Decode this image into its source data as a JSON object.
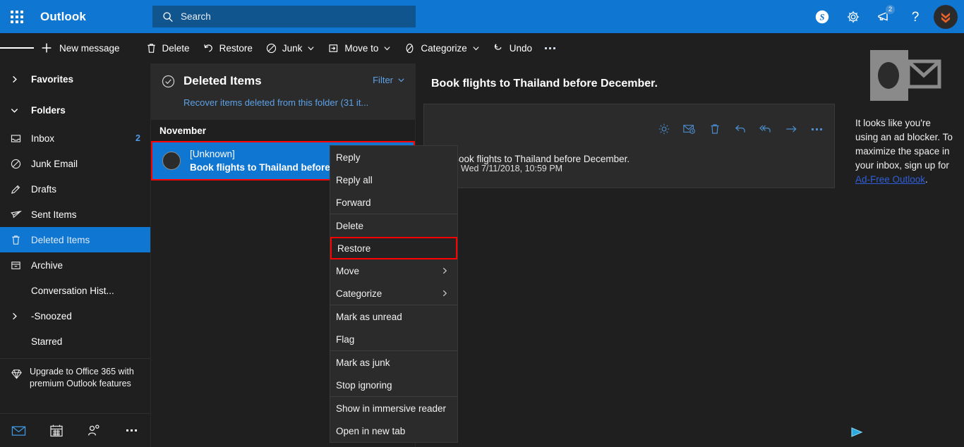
{
  "topbar": {
    "waffle_label": "app-launcher",
    "brand": "Outlook",
    "search_placeholder": "Search",
    "icons": {
      "skype": "skype-icon",
      "settings": "gear-icon",
      "announcements": "megaphone-icon",
      "help": "help-icon",
      "avatar": "user-avatar"
    },
    "notification_count": "2"
  },
  "commandbar": {
    "menu": "hamburger-menu",
    "new_message": "New message",
    "delete": "Delete",
    "restore": "Restore",
    "junk": "Junk",
    "move_to": "Move to",
    "categorize": "Categorize",
    "undo": "Undo",
    "more": "..."
  },
  "sidebar": {
    "favorites": "Favorites",
    "folders": "Folders",
    "items": [
      {
        "label": "Inbox",
        "icon": "inbox-icon",
        "count": "2"
      },
      {
        "label": "Junk Email",
        "icon": "junk-icon",
        "count": ""
      },
      {
        "label": "Drafts",
        "icon": "drafts-icon",
        "count": ""
      },
      {
        "label": "Sent Items",
        "icon": "sent-icon",
        "count": ""
      },
      {
        "label": "Deleted Items",
        "icon": "trash-icon",
        "count": ""
      },
      {
        "label": "Archive",
        "icon": "archive-icon",
        "count": ""
      },
      {
        "label": "Conversation Hist...",
        "icon": "",
        "count": ""
      },
      {
        "label": "-Snoozed",
        "icon": "",
        "count": ""
      },
      {
        "label": "Starred",
        "icon": "",
        "count": ""
      }
    ],
    "upgrade_text": "Upgrade to Office 365 with premium Outlook features",
    "bottom_nav": [
      "mail-icon",
      "calendar-icon",
      "people-icon",
      "more-icon"
    ]
  },
  "messagelist": {
    "title": "Deleted Items",
    "filter": "Filter",
    "recover_link": "Recover items deleted from this folder (31 it...",
    "group_header": "November",
    "items": [
      {
        "sender": "[Unknown]",
        "subject": "Book flights to Thailand before..",
        "selected": true
      }
    ]
  },
  "reading": {
    "subject": "Book flights to Thailand before December.",
    "date": "Wed 7/11/2018, 10:59 PM",
    "body": "Book flights to Thailand before December.",
    "actions": [
      "brightness-icon",
      "mail-snooze-icon",
      "trash-icon",
      "reply-icon",
      "reply-all-icon",
      "forward-icon",
      "more-icon"
    ]
  },
  "rail": {
    "logo": "outlook-logo",
    "text_before": "It looks like you're using an ad blocker. To maximize the space in your inbox, sign up for ",
    "link": "Ad-Free Outlook",
    "text_after": "."
  },
  "contextmenu": {
    "groups": [
      {
        "items": [
          {
            "label": "Reply",
            "submenu": false,
            "highlight": false
          },
          {
            "label": "Reply all",
            "submenu": false,
            "highlight": false
          },
          {
            "label": "Forward",
            "submenu": false,
            "highlight": false
          }
        ]
      },
      {
        "items": [
          {
            "label": "Delete",
            "submenu": false,
            "highlight": false
          },
          {
            "label": "Restore",
            "submenu": false,
            "highlight": true
          },
          {
            "label": "Move",
            "submenu": true,
            "highlight": false
          },
          {
            "label": "Categorize",
            "submenu": true,
            "highlight": false
          }
        ]
      },
      {
        "items": [
          {
            "label": "Mark as unread",
            "submenu": false,
            "highlight": false
          },
          {
            "label": "Flag",
            "submenu": false,
            "highlight": false
          }
        ]
      },
      {
        "items": [
          {
            "label": "Mark as junk",
            "submenu": false,
            "highlight": false
          },
          {
            "label": "Stop ignoring",
            "submenu": false,
            "highlight": false
          }
        ]
      },
      {
        "items": [
          {
            "label": "Show in immersive reader",
            "submenu": false,
            "highlight": false
          },
          {
            "label": "Open in new tab",
            "submenu": false,
            "highlight": false
          }
        ]
      }
    ]
  },
  "colors": {
    "brand_blue": "#0f76d1",
    "search_blue": "#11558f",
    "accent_link": "#5ca2e8",
    "highlight_red": "#ff0000",
    "app_bg": "#1f1f1f",
    "panel_bg": "#2b2b2b"
  }
}
